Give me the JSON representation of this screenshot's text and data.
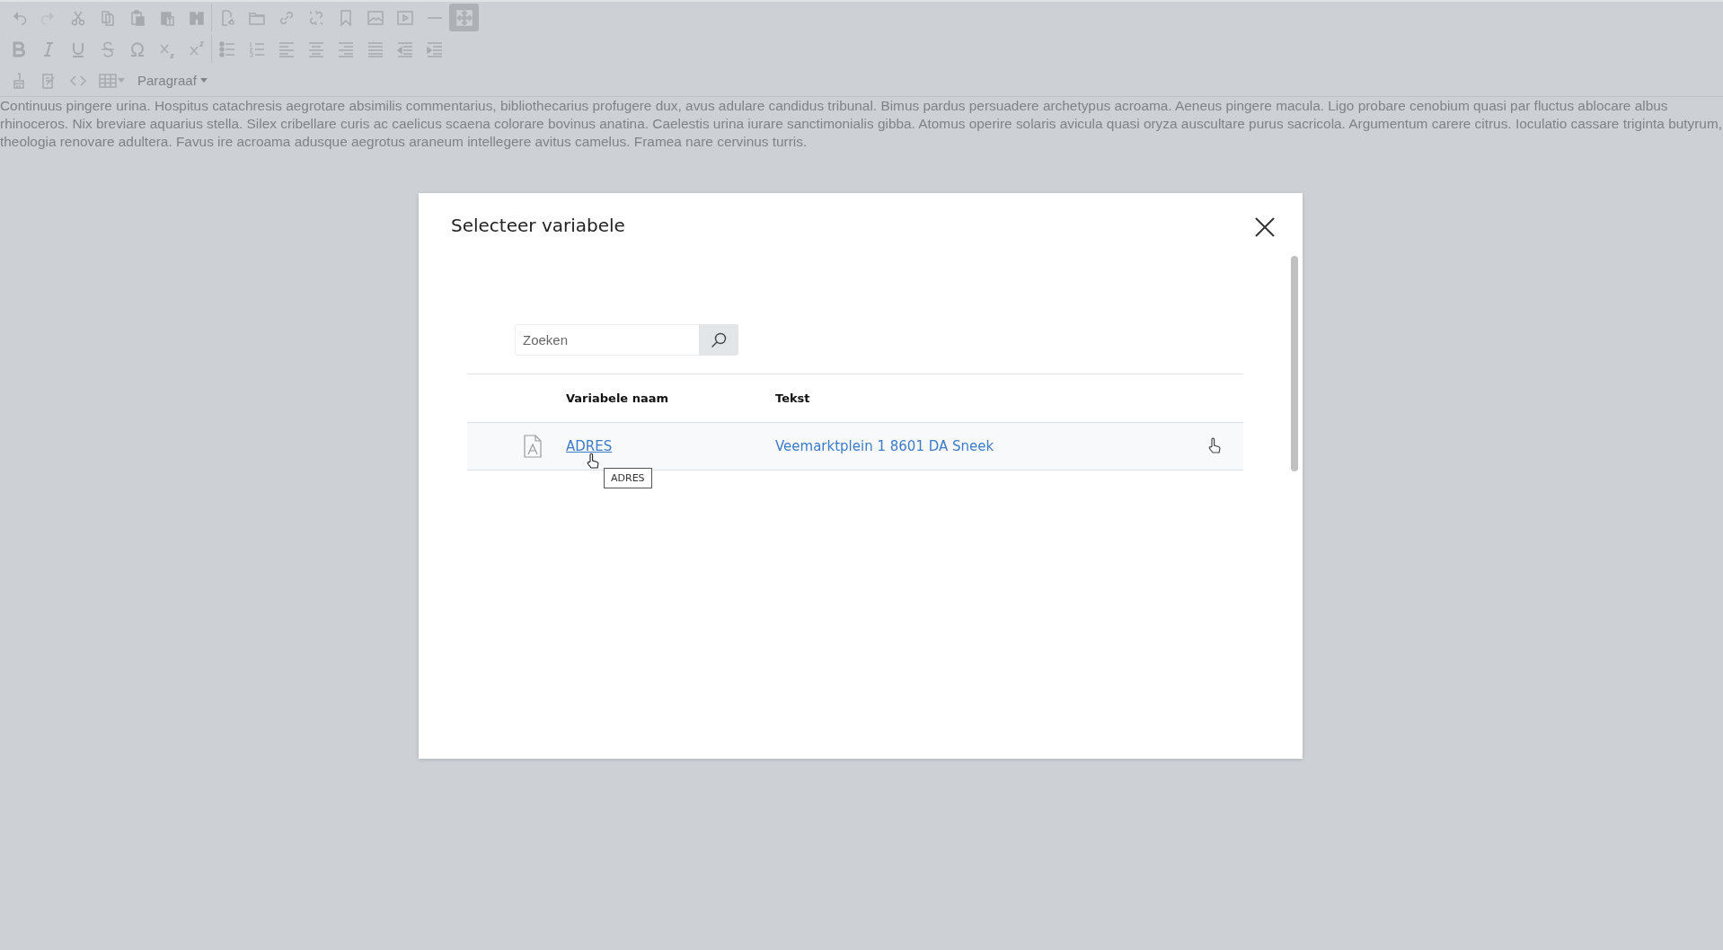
{
  "toolbar": {
    "rows": [
      {
        "groups": [
          [
            {
              "kind": "undo",
              "disabled": false,
              "active": false
            },
            {
              "kind": "redo",
              "disabled": true,
              "active": false
            },
            {
              "kind": "cut",
              "disabled": false,
              "active": false
            },
            {
              "kind": "copy",
              "disabled": false,
              "active": false
            },
            {
              "kind": "paste",
              "disabled": false,
              "active": false
            },
            {
              "kind": "paste-text",
              "disabled": false,
              "active": false
            },
            {
              "kind": "find",
              "disabled": false,
              "active": false
            }
          ],
          [
            {
              "kind": "file-link",
              "disabled": false,
              "active": false
            },
            {
              "kind": "folder",
              "disabled": false,
              "active": false
            },
            {
              "kind": "link",
              "disabled": false,
              "active": false
            },
            {
              "kind": "unlink",
              "disabled": false,
              "active": false
            },
            {
              "kind": "bookmark",
              "disabled": false,
              "active": false
            },
            {
              "kind": "image",
              "disabled": false,
              "active": false
            },
            {
              "kind": "media",
              "disabled": false,
              "active": false
            },
            {
              "kind": "rule",
              "disabled": false,
              "active": false
            },
            {
              "kind": "fullscreen",
              "disabled": false,
              "active": true
            }
          ]
        ]
      },
      {
        "groups": [
          [
            {
              "kind": "bold",
              "disabled": false,
              "active": false
            },
            {
              "kind": "italic",
              "disabled": false,
              "active": false
            },
            {
              "kind": "underline",
              "disabled": false,
              "active": false
            },
            {
              "kind": "strike",
              "disabled": false,
              "active": false
            },
            {
              "kind": "omega",
              "disabled": false,
              "active": false
            },
            {
              "kind": "subscript",
              "disabled": false,
              "active": false
            },
            {
              "kind": "superscript",
              "disabled": false,
              "active": false
            }
          ],
          [
            {
              "kind": "bullets",
              "disabled": false,
              "active": false
            },
            {
              "kind": "numbers",
              "disabled": false,
              "active": false
            },
            {
              "kind": "align-left",
              "disabled": false,
              "active": false
            },
            {
              "kind": "align-center",
              "disabled": false,
              "active": false
            },
            {
              "kind": "align-right",
              "disabled": false,
              "active": false
            },
            {
              "kind": "justify",
              "disabled": false,
              "active": false
            },
            {
              "kind": "outdent",
              "disabled": false,
              "active": false
            },
            {
              "kind": "indent",
              "disabled": false,
              "active": false
            }
          ]
        ]
      },
      {
        "groups": [
          [
            {
              "kind": "brush",
              "disabled": false,
              "active": false
            },
            {
              "kind": "edit",
              "disabled": false,
              "active": false
            },
            {
              "kind": "code",
              "disabled": false,
              "active": false
            },
            {
              "kind": "table",
              "disabled": false,
              "active": false
            }
          ]
        ]
      }
    ],
    "format_dropdown": {
      "label": "Paragraaf"
    }
  },
  "editor": {
    "text": "Continuus pingere urina. Hospitus catachresis aegrotare absimilis commentarius, bibliothecarius profugere dux, avus adulare candidus tribunal. Bimus pardus persuadere archetypus acroama. Aeneus pingere macula. Ligo probare cenobium quasi par fluctus ablocare albus rhinoceros. Nix breviare aquarius stella. Silex cribellare curis ac caelicus scaena colorare bovinus anatina. Caelestis urina iurare sanctimonialis gibba. Atomus operire solaris avicula quasi oryza auscultare purus sacricola. Argumentum carere citrus. Ioculatio cassare triginta butyrum, theologia renovare adultera. Favus ire acroama adusque aegrotus araneum intellegere avitus camelus. Framea nare cervinus turris."
  },
  "dialog": {
    "title": "Selecteer variabele",
    "search": {
      "placeholder": "Zoeken"
    },
    "table": {
      "columns": [
        "Variabele naam",
        "Tekst"
      ],
      "rows": [
        {
          "name": "ADRES",
          "text": "Veemarktplein 1 8601 DA Sneek",
          "hovered": true
        }
      ]
    },
    "tooltip": {
      "text": "ADRES"
    }
  }
}
